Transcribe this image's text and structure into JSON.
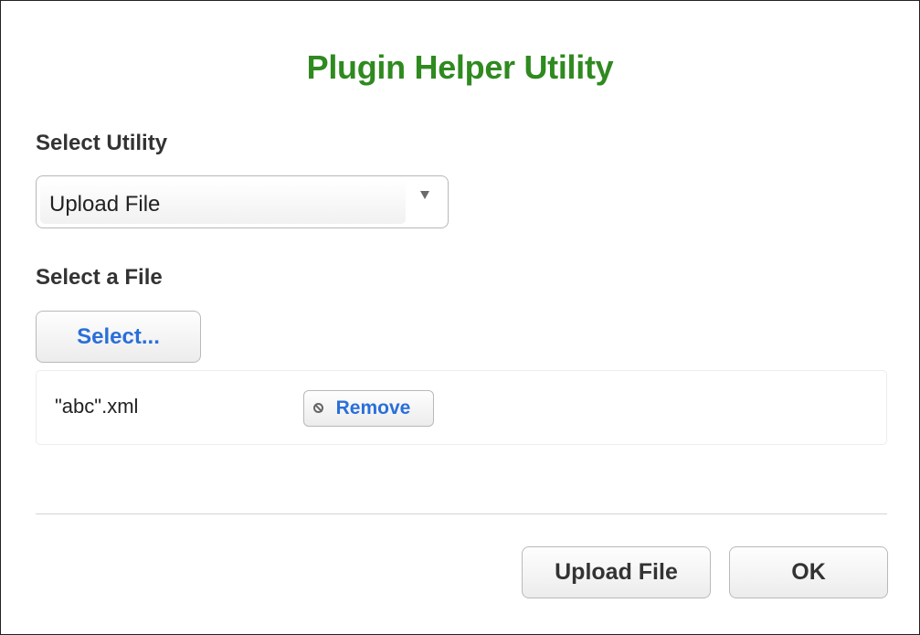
{
  "dialog": {
    "title": "Plugin Helper Utility",
    "title_color": "#2f8a1f",
    "accent_color": "#2a6fd9"
  },
  "utility": {
    "label": "Select Utility",
    "selected_value": "Upload File"
  },
  "file": {
    "label": "Select a File",
    "select_button": "Select...",
    "files": [
      {
        "name": "\"abc\".xml",
        "remove_icon": "remove-circle-icon",
        "remove_label": "Remove"
      }
    ]
  },
  "footer": {
    "upload_button": "Upload File",
    "ok_button": "OK"
  }
}
